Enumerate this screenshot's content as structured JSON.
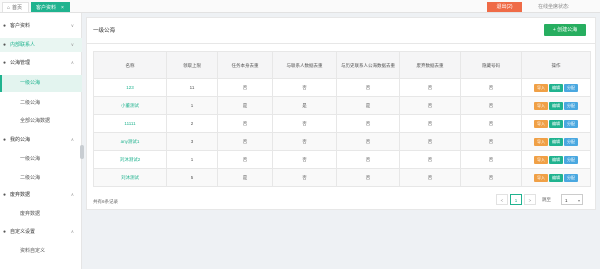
{
  "tabs": {
    "home_label": "首页",
    "active_label": "客户资料"
  },
  "header": {
    "logout_label": "退出(2)",
    "online_label": "在线坐席状态:"
  },
  "sidebar": {
    "groups": [
      {
        "label": "客户资料"
      },
      {
        "label": "内部联系人"
      },
      {
        "label": "公海管理"
      },
      {
        "label": "我的公海"
      },
      {
        "label": "废弃数据"
      },
      {
        "label": "自定义设置"
      }
    ],
    "items": [
      {
        "label": "一级公海"
      },
      {
        "label": "二级公海"
      },
      {
        "label": "全部公海数据"
      },
      {
        "label": "一级公海"
      },
      {
        "label": "二级公海"
      },
      {
        "label": "废弃数据"
      },
      {
        "label": "资料自定义"
      }
    ]
  },
  "main": {
    "title": "一级公海",
    "create_button": "+ 创建公海",
    "columns": [
      "名称",
      "领取上限",
      "任务本身去重",
      "与联系人数据去重",
      "与历史联系人公海数据去重",
      "废弃数据去重",
      "隐藏号码",
      "操作"
    ],
    "rows": [
      {
        "name": "123",
        "limit": "11",
        "c1": "否",
        "c2": "否",
        "c3": "否",
        "c4": "否",
        "c5": "否"
      },
      {
        "name": "小董测试",
        "limit": "1",
        "c1": "是",
        "c2": "是",
        "c3": "是",
        "c4": "否",
        "c5": "否"
      },
      {
        "name": "11111",
        "limit": "2",
        "c1": "否",
        "c2": "否",
        "c3": "否",
        "c4": "否",
        "c5": "否"
      },
      {
        "name": "any测试1",
        "limit": "3",
        "c1": "否",
        "c2": "否",
        "c3": "否",
        "c4": "否",
        "c5": "否"
      },
      {
        "name": "刘沐测试2",
        "limit": "1",
        "c1": "否",
        "c2": "否",
        "c3": "否",
        "c4": "否",
        "c5": "否"
      },
      {
        "name": "刘沐测试",
        "limit": "5",
        "c1": "是",
        "c2": "否",
        "c3": "否",
        "c4": "否",
        "c5": "否"
      }
    ],
    "actions": {
      "import": "导入",
      "edit": "编辑",
      "allocate": "分配"
    },
    "total_label": "共有6条记录",
    "pagination": {
      "prev": "<",
      "current": "1",
      "next": ">",
      "jump_label": "跳至",
      "page_value": "1"
    }
  },
  "colors": {
    "accent": "#20b38f",
    "create": "#27ae60",
    "logout": "#ef6b47",
    "import": "#f0a046",
    "allocate": "#4aa8e0"
  }
}
